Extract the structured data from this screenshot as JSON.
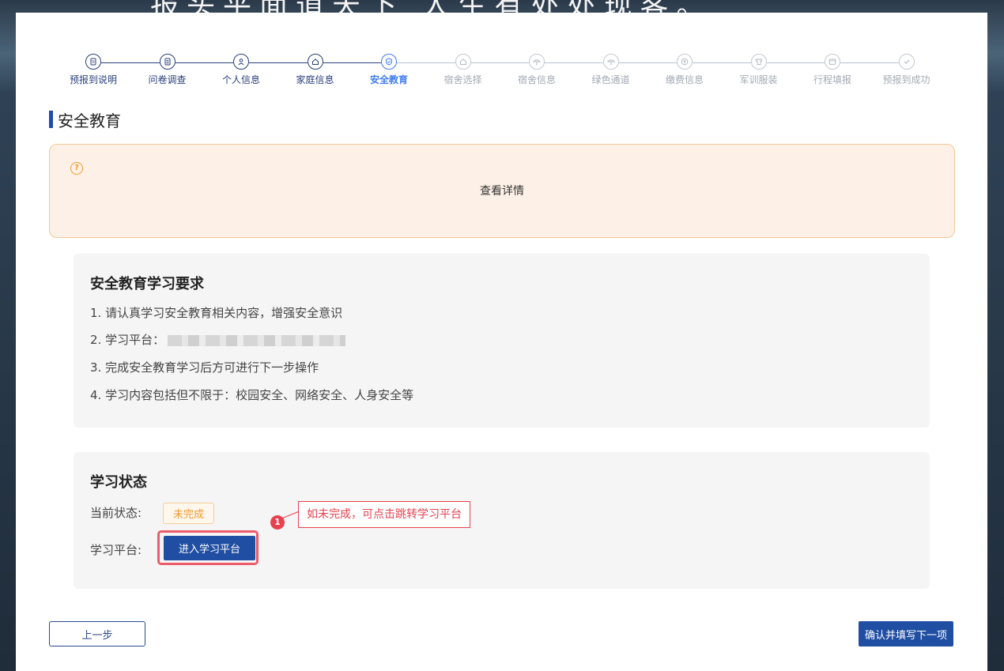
{
  "background_text": "报头平面道天下 人生有处处现客。",
  "steps": [
    {
      "label": "预报到说明",
      "icon": "document-icon",
      "state": "done"
    },
    {
      "label": "问卷调查",
      "icon": "clipboard-icon",
      "state": "done"
    },
    {
      "label": "个人信息",
      "icon": "user-icon",
      "state": "done"
    },
    {
      "label": "家庭信息",
      "icon": "home-icon",
      "state": "done"
    },
    {
      "label": "安全教育",
      "icon": "shield-icon",
      "state": "active"
    },
    {
      "label": "宿舍选择",
      "icon": "home-icon",
      "state": "pending"
    },
    {
      "label": "宿舍信息",
      "icon": "umbrella-icon",
      "state": "pending"
    },
    {
      "label": "绿色通道",
      "icon": "umbrella-icon",
      "state": "pending"
    },
    {
      "label": "缴费信息",
      "icon": "yen-icon",
      "state": "pending"
    },
    {
      "label": "军训服装",
      "icon": "shirt-icon",
      "state": "pending"
    },
    {
      "label": "行程填报",
      "icon": "wallet-icon",
      "state": "pending"
    },
    {
      "label": "预报到成功",
      "icon": "check-icon",
      "state": "pending"
    }
  ],
  "section_title": "安全教育",
  "notice": {
    "link_text": "查看详情"
  },
  "requirements": {
    "title": "安全教育学习要求",
    "items": [
      "1. 请认真学习安全教育相关内容，增强安全意识",
      "2. 学习平台：",
      "3. 完成安全教育学习后方可进行下一步操作",
      "4. 学习内容包括但不限于：校园安全、网络安全、人身安全等"
    ]
  },
  "status": {
    "title": "学习状态",
    "current_label": "当前状态:",
    "current_value": "未完成",
    "platform_label": "学习平台:",
    "enter_button": "进入学习平台"
  },
  "callout": {
    "number": "1",
    "text": "如未完成，可点击跳转学习平台"
  },
  "nav": {
    "prev": "上一步",
    "next": "确认并填写下一项"
  },
  "colors": {
    "primary": "#1f4ea3",
    "active_step": "#3f7bf0",
    "warning": "#f09a2e",
    "callout": "#e8414e"
  }
}
